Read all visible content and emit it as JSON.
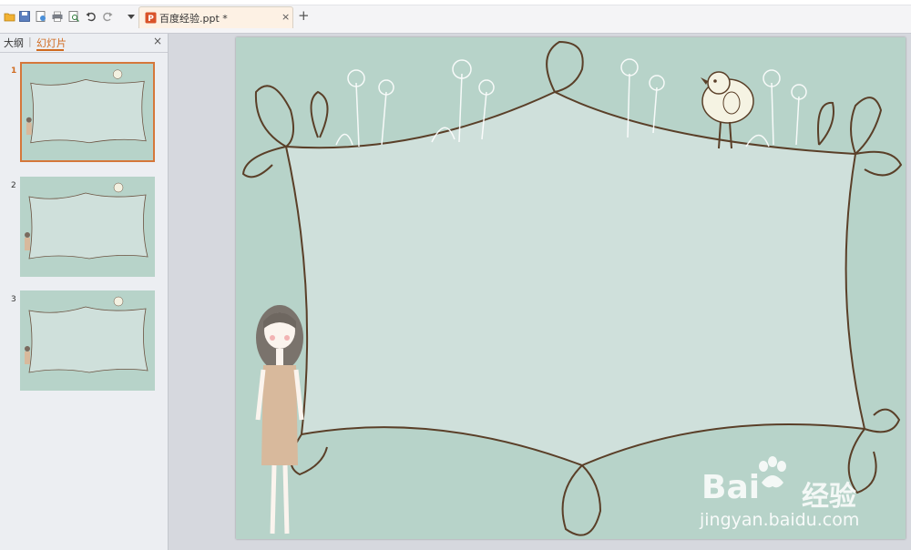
{
  "toolbar": {
    "icons": [
      "open-folder-icon",
      "save-icon",
      "save-as-icon",
      "print-icon",
      "print-preview-icon",
      "undo-icon",
      "redo-icon",
      "dropdown-icon"
    ]
  },
  "document_tab": {
    "name": "百度经验.ppt *",
    "close": "×",
    "new_tab": "+"
  },
  "panel": {
    "outline_label": "大纲",
    "separator": "|",
    "slides_label": "幻灯片",
    "close": "×",
    "slides": [
      {
        "number": "1",
        "selected": true
      },
      {
        "number": "2",
        "selected": false
      },
      {
        "number": "3",
        "selected": false
      }
    ]
  },
  "watermark": {
    "brand_latin": "Bai",
    "brand_cn": "经验",
    "url": "jingyan.baidu.com"
  },
  "colors": {
    "accent": "#d06a1f",
    "slide_bg": "#b7d3c9",
    "frame_fill": "#cfe0db",
    "frame_stroke": "#5a3f28"
  }
}
